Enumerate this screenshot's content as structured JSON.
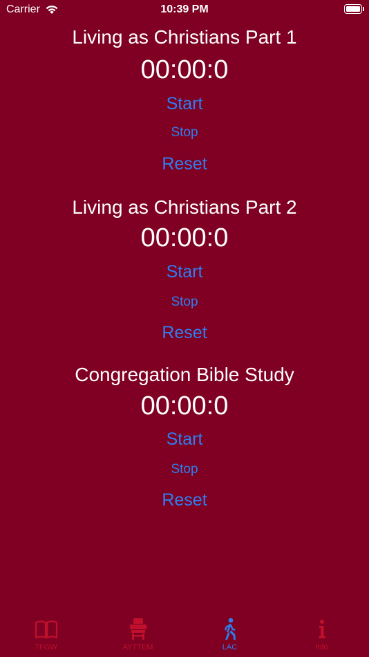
{
  "status_bar": {
    "carrier": "Carrier",
    "time": "10:39 PM"
  },
  "timers": [
    {
      "title": "Living as Christians Part 1",
      "display": "00:00:0",
      "start_label": "Start",
      "stop_label": "Stop",
      "reset_label": "Reset"
    },
    {
      "title": "Living as Christians Part 2",
      "display": "00:00:0",
      "start_label": "Start",
      "stop_label": "Stop",
      "reset_label": "Reset"
    },
    {
      "title": "Congregation Bible Study",
      "display": "00:00:0",
      "start_label": "Start",
      "stop_label": "Stop",
      "reset_label": "Reset"
    }
  ],
  "tab_bar": {
    "tabs": [
      {
        "label": "TFGW",
        "icon": "book-icon",
        "active": false
      },
      {
        "label": "AYTTEM",
        "icon": "lectern-icon",
        "active": false
      },
      {
        "label": "LAC",
        "icon": "walking-person-icon",
        "active": true
      },
      {
        "label": "Info",
        "icon": "info-icon",
        "active": false
      }
    ]
  },
  "colors": {
    "background": "#7f0022",
    "accent_blue": "#2d7ff0",
    "tab_inactive": "#c0102c",
    "text": "#ffffff"
  }
}
